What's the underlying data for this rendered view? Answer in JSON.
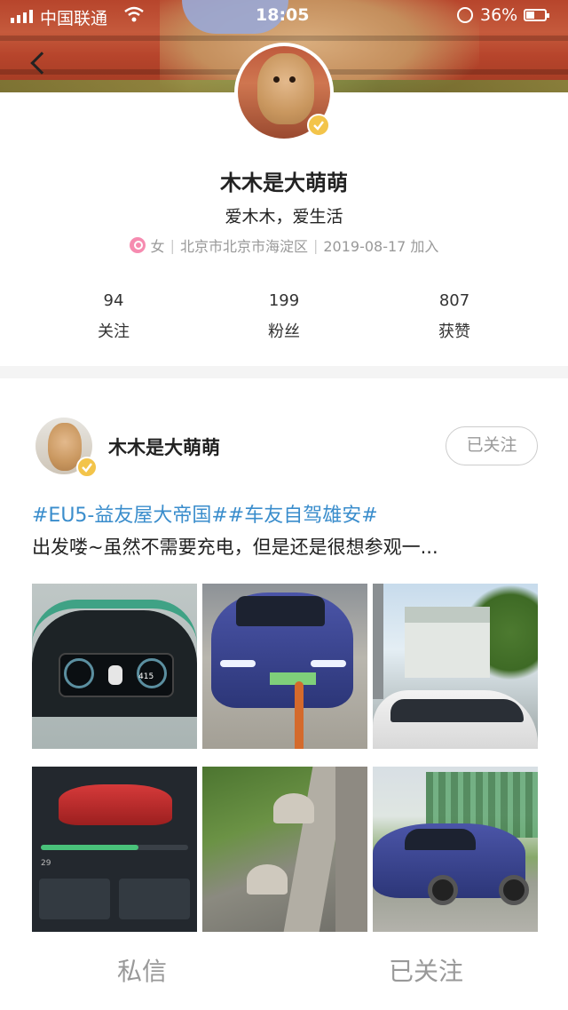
{
  "status_bar": {
    "carrier": "中国联通",
    "time": "18:05",
    "battery": "36%"
  },
  "header": {
    "back_icon": "chevron-left-icon"
  },
  "profile": {
    "nickname": "木木是大萌萌",
    "bio": "爱木木，爱生活",
    "gender": "女",
    "location": "北京市北京市海淀区",
    "joined": "2019-08-17 加入",
    "stats": [
      {
        "count": "94",
        "label": "关注"
      },
      {
        "count": "199",
        "label": "粉丝"
      },
      {
        "count": "807",
        "label": "获赞"
      }
    ]
  },
  "post": {
    "author": "木木是大萌萌",
    "follow_status": "已关注",
    "tags": "#EU5-益友屋大帝国##车友自驾雄安#",
    "text": "出发喽~虽然不需要充电，但是还是很想参观一...",
    "photos": [
      {
        "name": "dashboard-photo",
        "text": "415"
      },
      {
        "name": "car-charging-photo"
      },
      {
        "name": "building-photo"
      },
      {
        "name": "app-screenshot-photo",
        "text": "29"
      },
      {
        "name": "garden-photo"
      },
      {
        "name": "blue-car-photo"
      }
    ]
  },
  "bottom_bar": {
    "message_label": "私信",
    "follow_label": "已关注"
  },
  "colors": {
    "tag_blue": "#3a8dcc",
    "badge_gold": "#f3c44a",
    "gender_pink": "#f68bb0"
  }
}
